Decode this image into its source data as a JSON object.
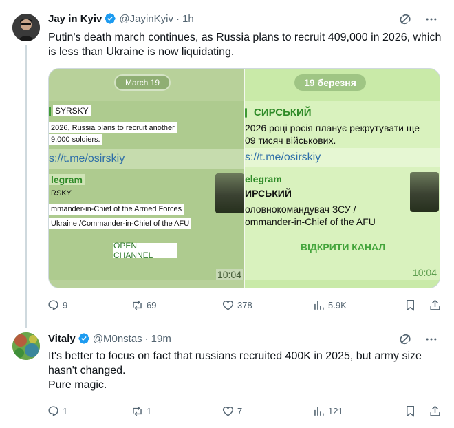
{
  "post1": {
    "author": "Jay in Kyiv",
    "handle": "@JayinKyiv",
    "dot": "·",
    "time": "1h",
    "text": "Putin's death march continues, as Russia plans to recruit 409,000 in 2026, which is less than Ukraine is now liquidating.",
    "media": {
      "left": {
        "date": "March 19",
        "label": "SYRSKY",
        "line1": "2026, Russia plans to recruit another",
        "line2": "9,000 soldiers.",
        "link": "s://t.me/osirskiy",
        "telegram": "legram",
        "channel": "RSKY",
        "desc1": "mmander-in-Chief of the Armed Forces",
        "desc2": "Ukraine /Commander-in-Chief of the AFU",
        "button": "OPEN CHANNEL",
        "time": "10:04"
      },
      "right": {
        "date": "19 березня",
        "label": "СИРСЬКИЙ",
        "line1": "2026 році росія планує рекрутувати ще",
        "line2": "09 тисяч військових.",
        "link": "s://t.me/osirskiy",
        "telegram": "elegram",
        "channel": "ИРСЬКИЙ",
        "desc1": "оловнокомандувач ЗСУ /",
        "desc2": "ommander-in-Chief of the AFU",
        "button": "ВІДКРИТИ КАНАЛ",
        "time": "10:04"
      }
    },
    "stats": {
      "replies": "9",
      "reposts": "69",
      "likes": "378",
      "views": "5.9K"
    }
  },
  "post2": {
    "author": "Vitaly",
    "handle": "@M0nstas",
    "dot": "·",
    "time": "19m",
    "text": "It's better to focus on fact that russians recruited 400K in 2025, but army size hasn't changed.\nPure magic.",
    "stats": {
      "replies": "1",
      "reposts": "1",
      "likes": "7",
      "views": "121"
    }
  },
  "icons": {
    "verified": "verified-badge-icon",
    "grok": "grok-icon",
    "more": "more-icon",
    "reply": "reply-icon",
    "repost": "repost-icon",
    "like": "like-icon",
    "views": "views-icon",
    "bookmark": "bookmark-icon",
    "share": "share-icon"
  },
  "colors": {
    "accent": "#1d9bf0",
    "text": "#0f1419",
    "muted": "#536471"
  }
}
